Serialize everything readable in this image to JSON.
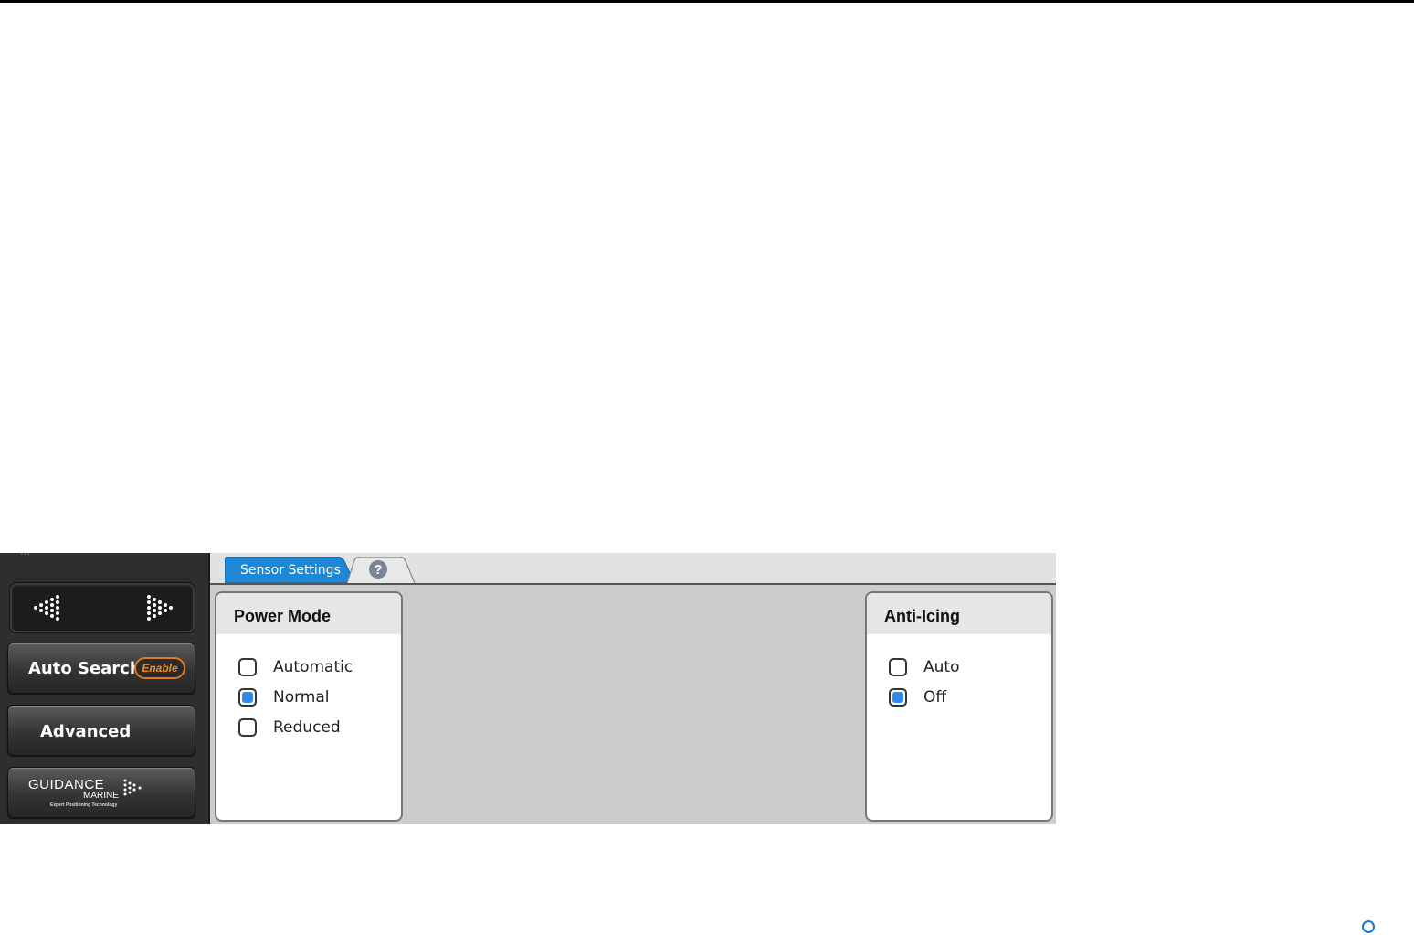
{
  "sidebar": {
    "clipped_label": "...",
    "auto_search": {
      "label": "Auto Search",
      "badge": "Enable"
    },
    "advanced": {
      "label": "Advanced"
    },
    "logo": {
      "name": "GUIDANCE",
      "sub": "MARINE",
      "tagline": "Expert Positioning Technology"
    }
  },
  "tabs": [
    {
      "label": "Sensor Settings",
      "active": true
    },
    {
      "label": "?",
      "icon": "help-icon",
      "active": false
    }
  ],
  "power_mode": {
    "title": "Power Mode",
    "options": [
      {
        "label": "Automatic",
        "checked": false
      },
      {
        "label": "Normal",
        "checked": true
      },
      {
        "label": "Reduced",
        "checked": false
      }
    ]
  },
  "anti_icing": {
    "title": "Anti-Icing",
    "options": [
      {
        "label": "Auto",
        "checked": false
      },
      {
        "label": "Off",
        "checked": true
      }
    ]
  },
  "colors": {
    "accent": "#2e8bea",
    "tab_active": "#1f88d6",
    "badge": "#e07b1c"
  }
}
